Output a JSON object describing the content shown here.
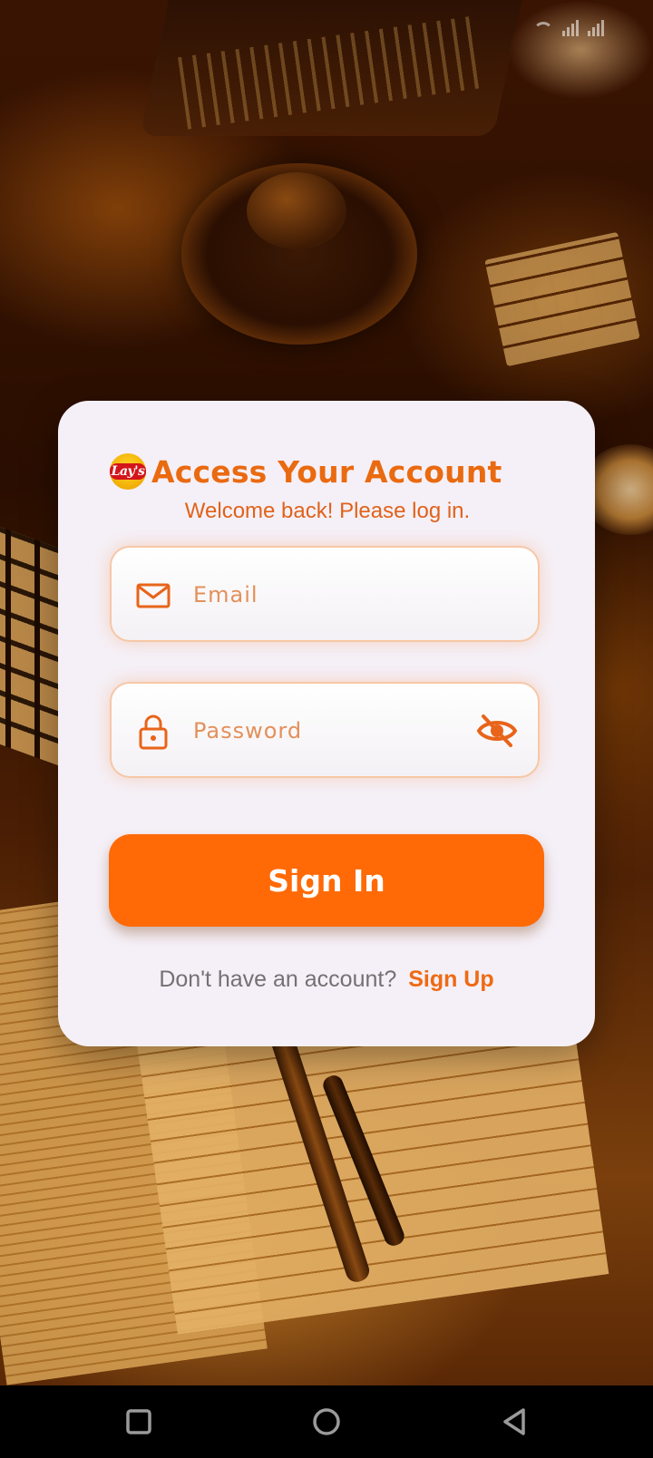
{
  "card": {
    "title": "Access Your Account",
    "subtitle": "Welcome back! Please log in.",
    "logo_text": "Lay's",
    "email": {
      "placeholder": "Email",
      "value": ""
    },
    "password": {
      "placeholder": "Password",
      "value": ""
    },
    "signin_label": "Sign In",
    "signup_prompt": "Don't have an account?",
    "signup_link": "Sign Up"
  },
  "icons": {
    "email": "mail-icon",
    "password": "lock-icon",
    "visibility": "eye-off-icon",
    "nav": [
      "recent-apps-icon",
      "home-icon",
      "back-icon"
    ]
  },
  "colors": {
    "accent": "#ff6a06",
    "title": "#ea6a10",
    "card_bg": "#f5f0f7",
    "field_border": "#f6c7a6"
  }
}
